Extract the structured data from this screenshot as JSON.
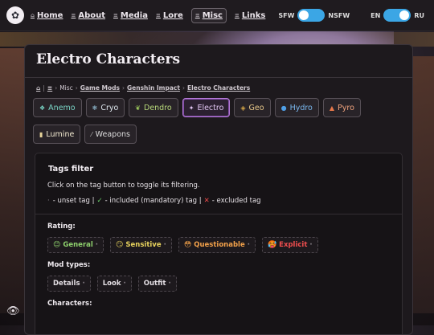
{
  "nav": {
    "links": [
      {
        "label": "Home"
      },
      {
        "label": "About"
      },
      {
        "label": "Media"
      },
      {
        "label": "Lore"
      },
      {
        "label": "Misc"
      },
      {
        "label": "Links"
      }
    ],
    "sfw_label": "SFW",
    "nsfw_label": "NSFW",
    "lang_en": "EN",
    "lang_ru": "RU"
  },
  "page": {
    "title": "Electro Characters",
    "breadcrumb": {
      "home_icon": "⌂",
      "misc": "Misc",
      "game_mods": "Game Mods",
      "genshin": "Genshin Impact",
      "current": "Electro Characters"
    }
  },
  "element_tags": [
    {
      "label": "Anemo",
      "icon": "❖"
    },
    {
      "label": "Cryo",
      "icon": "❄"
    },
    {
      "label": "Dendro",
      "icon": "❦"
    },
    {
      "label": "Electro",
      "icon": "✦"
    },
    {
      "label": "Geo",
      "icon": "◈"
    },
    {
      "label": "Hydro",
      "icon": "●"
    },
    {
      "label": "Pyro",
      "icon": "▲"
    },
    {
      "label": "Lumine",
      "icon": "▮"
    },
    {
      "label": "Weapons",
      "icon": "⁄"
    }
  ],
  "filter": {
    "title": "Tags filter",
    "description": "Click on the tag button to toggle its filtering.",
    "legend_unset": "- unset tag |",
    "legend_included": "- included (mandatory) tag |",
    "legend_excluded": "- excluded tag",
    "rating_label": "Rating:",
    "ratings": [
      {
        "label": "General",
        "emoji": "😊"
      },
      {
        "label": "Sensitive",
        "emoji": "😏"
      },
      {
        "label": "Questionable",
        "emoji": "😳"
      },
      {
        "label": "Explicit",
        "emoji": "🥵"
      }
    ],
    "modtypes_label": "Mod types:",
    "modtypes": [
      {
        "label": "Details"
      },
      {
        "label": "Look"
      },
      {
        "label": "Outfit"
      }
    ],
    "characters_label": "Characters:"
  }
}
